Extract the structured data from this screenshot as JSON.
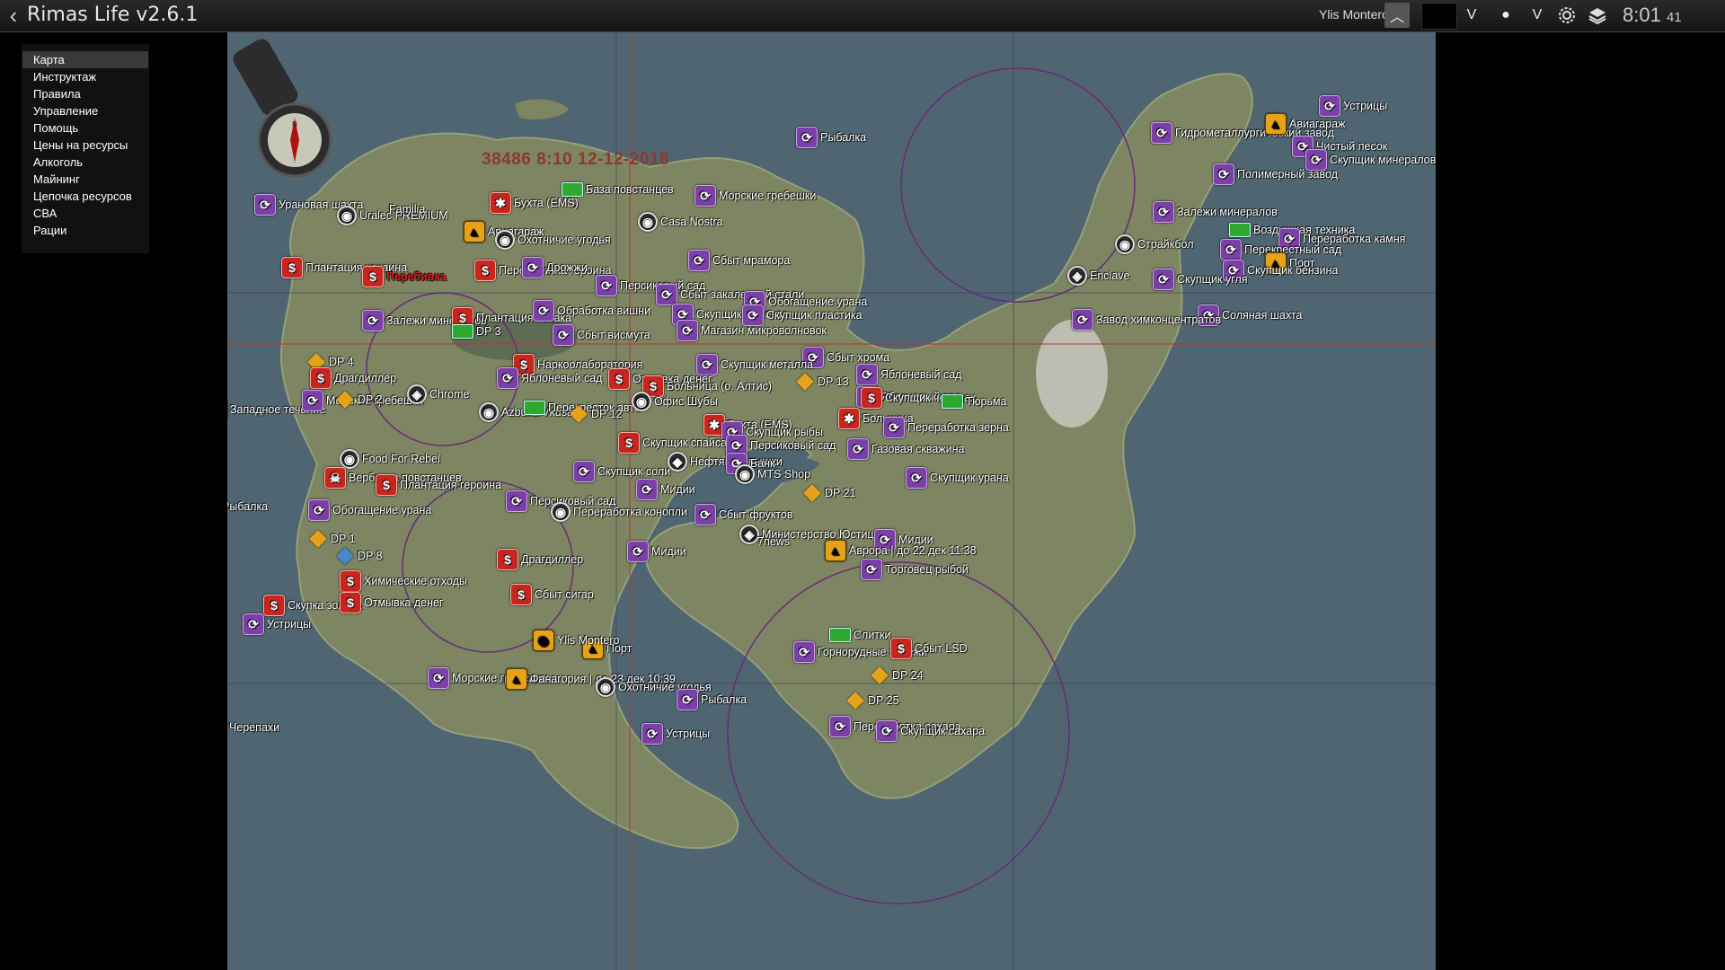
{
  "app": {
    "title": "Rimas Life v2.6.1",
    "player": "Ylis Montero"
  },
  "clock": {
    "time": "8:01",
    "seconds": "41"
  },
  "menu": [
    {
      "label": "Карта",
      "active": true
    },
    {
      "label": "Инструктаж"
    },
    {
      "label": "Правила"
    },
    {
      "label": "Управление"
    },
    {
      "label": "Помощь"
    },
    {
      "label": "Цены на ресурсы"
    },
    {
      "label": "Алкоголь"
    },
    {
      "label": "Майнинг"
    },
    {
      "label": "Цепочка ресурсов"
    },
    {
      "label": "СВА"
    },
    {
      "label": "Рации"
    }
  ],
  "map": {
    "date_stamp": "38486 8:10 12-12-2018",
    "markers": [
      {
        "label": "Устрицы",
        "icon": "purple"
      },
      {
        "label": "Рыбалка",
        "icon": "purple"
      },
      {
        "label": "Гидрометаллургический завод",
        "icon": "purple"
      },
      {
        "label": "Авиагараж",
        "icon": "yellow"
      },
      {
        "label": "Чистый песок",
        "icon": "purple"
      },
      {
        "label": "Скупщик минералов",
        "icon": "purple"
      },
      {
        "label": "Полимерный завод",
        "icon": "purple"
      },
      {
        "label": "Залежи минералов",
        "icon": "purple"
      },
      {
        "label": "Воздушная техника",
        "icon": "green"
      },
      {
        "label": "Переработка камня",
        "icon": "purple"
      },
      {
        "label": "Страйкбол",
        "icon": "gray"
      },
      {
        "label": "Перекрестный сад",
        "icon": "purple"
      },
      {
        "label": "Порт",
        "icon": "yellow"
      },
      {
        "label": "Скупщик бензина",
        "icon": "purple"
      },
      {
        "label": "Enclave",
        "icon": "badge"
      },
      {
        "label": "Скупщик угля",
        "icon": "purple"
      },
      {
        "label": "Соляная шахта",
        "icon": "purple"
      },
      {
        "label": "Завод химконцентратов",
        "icon": "purple"
      },
      {
        "label": "Урановая шахта",
        "icon": "purple"
      },
      {
        "label": "Uralec PREMIUM",
        "icon": "gray"
      },
      {
        "label": "Familia",
        "icon": "none"
      },
      {
        "label": "Бухта (EMS)",
        "icon": "ems"
      },
      {
        "label": "База повстанцев",
        "icon": "green"
      },
      {
        "label": "Морские гребешки",
        "icon": "purple"
      },
      {
        "label": "Casa Nostra",
        "icon": "gray"
      },
      {
        "label": "Авиагараж",
        "icon": "yellow"
      },
      {
        "label": "Охотничие угодья",
        "icon": "gray"
      },
      {
        "label": "Плантация кокаина",
        "icon": "red"
      },
      {
        "label": "Перебивка",
        "icon": "red"
      },
      {
        "label": "Переработка героина",
        "icon": "red"
      },
      {
        "label": "Дрожжи",
        "icon": "purple"
      },
      {
        "label": "Сбыт мрамора",
        "icon": "purple"
      },
      {
        "label": "Персиковый сад",
        "icon": "purple"
      },
      {
        "label": "Сбыт закаленной стали",
        "icon": "purple"
      },
      {
        "label": "Обогащение урана",
        "icon": "purple"
      },
      {
        "label": "Залежи минералов",
        "icon": "purple"
      },
      {
        "label": "Плантация табака",
        "icon": "red"
      },
      {
        "label": "Обработка вишни",
        "icon": "purple"
      },
      {
        "label": "DP 3",
        "icon": "green"
      },
      {
        "label": "Сбыт висмута",
        "icon": "purple"
      },
      {
        "label": "Скупщик цемента",
        "icon": "purple"
      },
      {
        "label": "Скупщик пластика",
        "icon": "purple"
      },
      {
        "label": "Магазин микроволновок",
        "icon": "purple"
      },
      {
        "label": "Наркоолаборатория",
        "icon": "red"
      },
      {
        "label": "Яблоневый сад",
        "icon": "purple"
      },
      {
        "label": "Сбыт хрома",
        "icon": "purple"
      },
      {
        "label": "Скупщик металла",
        "icon": "purple"
      },
      {
        "label": "Яблоневый сад",
        "icon": "purple"
      },
      {
        "label": "DP 4",
        "icon": "diamond"
      },
      {
        "label": "Драгдиллер",
        "icon": "red"
      },
      {
        "label": "Отмывка денег",
        "icon": "red"
      },
      {
        "label": "Больница (о. Алтис)",
        "icon": "red"
      },
      {
        "label": "DP 13",
        "icon": "diamond"
      },
      {
        "label": "Яблоневый сад",
        "icon": "purple"
      },
      {
        "label": "Скупщик черепах",
        "icon": "red"
      },
      {
        "label": "Тюрьма",
        "icon": "green"
      },
      {
        "label": "Западное течение",
        "icon": "red"
      },
      {
        "label": "Морские гребешки",
        "icon": "purple"
      },
      {
        "label": "DP 2",
        "icon": "diamond"
      },
      {
        "label": "Chrome",
        "icon": "badge"
      },
      {
        "label": "Azbuka Vkusa",
        "icon": "gray"
      },
      {
        "label": "Перекрёсток авто",
        "icon": "green"
      },
      {
        "label": "DP 12",
        "icon": "diamond"
      },
      {
        "label": "Офис Шубы",
        "icon": "gray"
      },
      {
        "label": "Бухта (EMS)",
        "icon": "ems"
      },
      {
        "label": "Скупщик рыбы",
        "icon": "purple"
      },
      {
        "label": "Больница",
        "icon": "ems"
      },
      {
        "label": "Переработка зерна",
        "icon": "purple"
      },
      {
        "label": "Газовая скважина",
        "icon": "purple"
      },
      {
        "label": "Скупщик спайса",
        "icon": "red"
      },
      {
        "label": "Персиковый сад",
        "icon": "purple"
      },
      {
        "label": "Food For Rebel",
        "icon": "gray"
      },
      {
        "label": "Вербовка повстанцев",
        "icon": "skull"
      },
      {
        "label": "Плантация героина",
        "icon": "red"
      },
      {
        "label": "Нефтяные вышки",
        "icon": "oil"
      },
      {
        "label": "Банк",
        "icon": "purple"
      },
      {
        "label": "MTS Shop",
        "icon": "gray"
      },
      {
        "label": "Скупщик урана",
        "icon": "purple"
      },
      {
        "label": "Скупщик соли",
        "icon": "purple"
      },
      {
        "label": "Мидии",
        "icon": "purple"
      },
      {
        "label": "DP 21",
        "icon": "diamond"
      },
      {
        "label": "Рыбалка",
        "icon": "purple"
      },
      {
        "label": "Обогащение урана",
        "icon": "purple"
      },
      {
        "label": "Персиковый сад",
        "icon": "purple"
      },
      {
        "label": "Переработка конопли",
        "icon": "gray"
      },
      {
        "label": "Сбыт фруктов",
        "icon": "purple"
      },
      {
        "label": "Министерство Юстиции",
        "icon": "badge"
      },
      {
        "label": "7news",
        "icon": "none"
      },
      {
        "label": "Мидии",
        "icon": "purple"
      },
      {
        "label": "Аврора | до 22 дек 11:38",
        "icon": "yellow"
      },
      {
        "label": "DP 1",
        "icon": "diamond"
      },
      {
        "label": "DP 8",
        "icon": "bluediamond"
      },
      {
        "label": "Драгдиллер",
        "icon": "red"
      },
      {
        "label": "Мидии",
        "icon": "purple"
      },
      {
        "label": "Торговец рыбой",
        "icon": "purple"
      },
      {
        "label": "Химические отходы",
        "icon": "red"
      },
      {
        "label": "Сбыт сигар",
        "icon": "red"
      },
      {
        "label": "Скупка золота",
        "icon": "red"
      },
      {
        "label": "Отмывка денег",
        "icon": "red"
      },
      {
        "label": "Устрицы",
        "icon": "purple"
      },
      {
        "label": "Слитки",
        "icon": "green"
      },
      {
        "label": "Горнорудные залежи",
        "icon": "purple"
      },
      {
        "label": "Сбыт LSD",
        "icon": "red"
      },
      {
        "label": "Порт",
        "icon": "yellow"
      },
      {
        "label": "Морские гребешки",
        "icon": "purple"
      },
      {
        "label": "Фанагория | до 23 дек 10:39",
        "icon": "yellow"
      },
      {
        "label": "Охотничие угодья",
        "icon": "gray"
      },
      {
        "label": "Рыбалка",
        "icon": "purple"
      },
      {
        "label": "DP 24",
        "icon": "diamond"
      },
      {
        "label": "DP 25",
        "icon": "diamond"
      },
      {
        "label": "Переработка сахара",
        "icon": "purple"
      },
      {
        "label": "Скупщик сахара",
        "icon": "purple"
      },
      {
        "label": "Черепахи",
        "icon": "red"
      },
      {
        "label": "Устрицы",
        "icon": "purple"
      },
      {
        "label": "Ylis Montero",
        "icon": "player"
      }
    ]
  },
  "colors": {
    "sea": "#4f6672",
    "land": "#7d8563",
    "purple": "#7b3fa8",
    "red": "#c9251f",
    "yellow": "#e6a31a",
    "green": "#2fa82f"
  }
}
